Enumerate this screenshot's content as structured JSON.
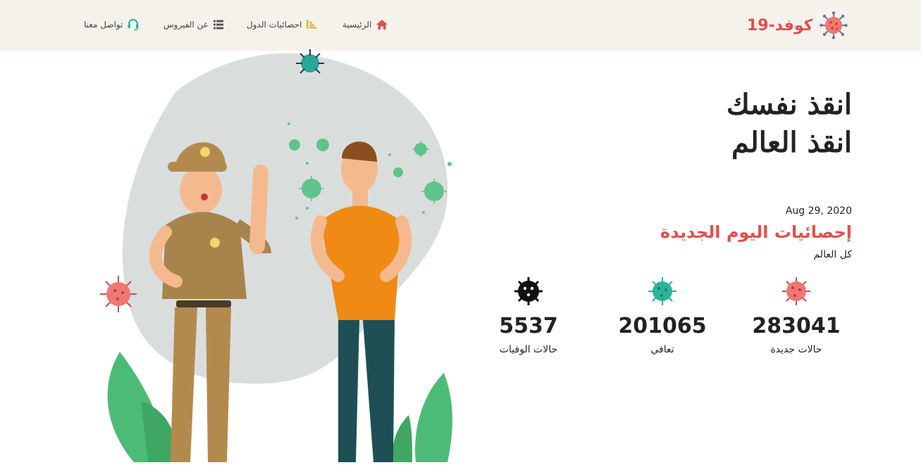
{
  "brand": {
    "name": "كوفد-19",
    "icon": "virus-icon",
    "color": "#e0504f"
  },
  "nav": {
    "items": [
      {
        "label": "الرئيسية",
        "icon": "home-icon",
        "color": "#e0504f"
      },
      {
        "label": "احصائيات الدول",
        "icon": "bar-chart-icon",
        "color": "#e7b53a"
      },
      {
        "label": "عن الفيروس",
        "icon": "list-icon",
        "color": "#555555"
      },
      {
        "label": "تواصل معنا",
        "icon": "headset-icon",
        "color": "#2bb39a"
      }
    ]
  },
  "hero": {
    "line1": "انقذ نفسك",
    "line2": "انقذ العالم"
  },
  "stats": {
    "date": "Aug 29, 2020",
    "title": "إحصائيات اليوم الجديدة",
    "scope": "كل العالم",
    "items": [
      {
        "value": "283041",
        "label": "حالات جديدة",
        "icon": "red-virus-icon",
        "color": "#e0504f"
      },
      {
        "value": "201065",
        "label": "تعافي",
        "icon": "teal-virus-icon",
        "color": "#2bb39a"
      },
      {
        "value": "5537",
        "label": "حالات الوفيات",
        "icon": "black-virus-icon",
        "color": "#111111"
      }
    ]
  }
}
